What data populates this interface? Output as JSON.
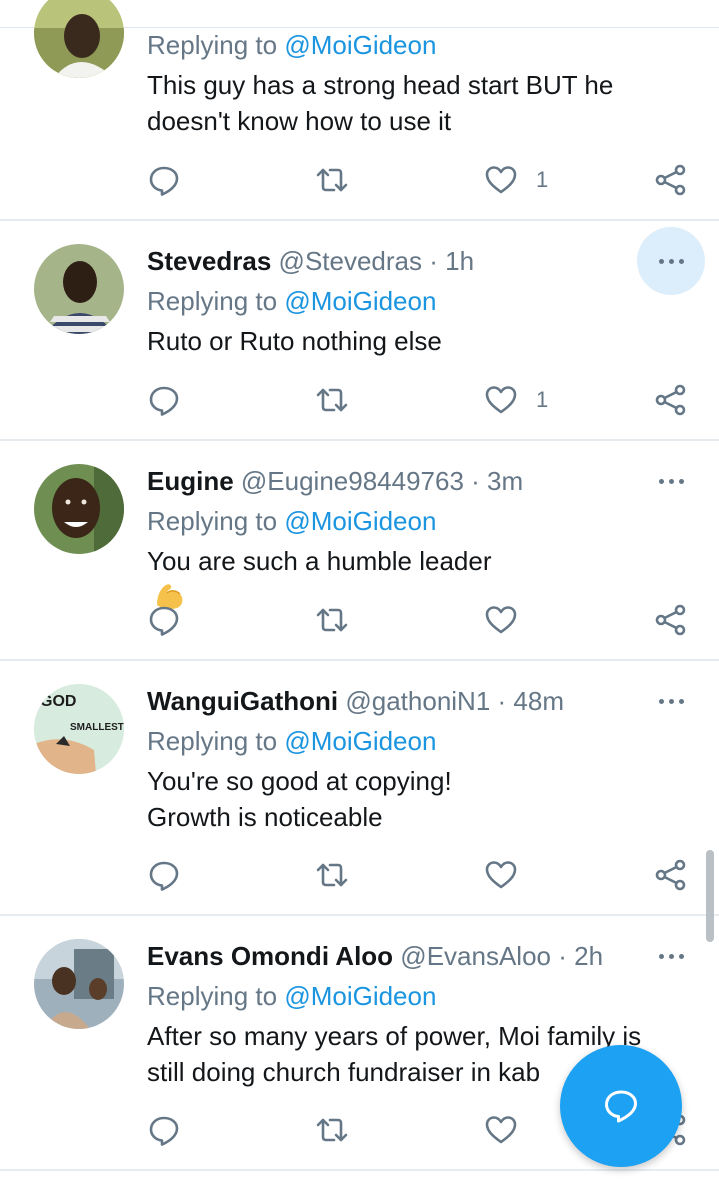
{
  "colors": {
    "accent": "#1da1f2",
    "link": "#1b95e0",
    "meta": "#657786",
    "text": "#14171a"
  },
  "tweets": [
    {
      "name": "",
      "handle": "",
      "time": "",
      "replying_prefix": "Replying to",
      "replying_to": "@MoiGideon",
      "text_lines": [
        "This guy has a strong head start BUT he",
        "doesn't know how to use it"
      ],
      "like_count": "1"
    },
    {
      "name": "Stevedras",
      "handle": "@Stevedras",
      "time": "· 1h",
      "replying_prefix": "Replying to",
      "replying_to": "@MoiGideon",
      "text_lines": [
        "Ruto or Ruto nothing else"
      ],
      "like_count": "1"
    },
    {
      "name": "Eugine",
      "handle": "@Eugine98449763",
      "time": "· 3m",
      "replying_prefix": "Replying to",
      "replying_to": "@MoiGideon",
      "text_lines": [
        "You are such a humble leader"
      ],
      "emoji": "flexed-biceps",
      "like_count": ""
    },
    {
      "name": "WanguiGathoni",
      "handle": "@gathoniN1",
      "time": "· 48m",
      "replying_prefix": "Replying to",
      "replying_to": "@MoiGideon",
      "text_lines": [
        "You're so good at copying!",
        "Growth is noticeable"
      ],
      "avatar_text": [
        "GOD",
        "SMALLEST"
      ],
      "like_count": ""
    },
    {
      "name": "Evans Omondi Aloo",
      "handle": "@EvansAloo",
      "time": "· 2h",
      "replying_prefix": "Replying to",
      "replying_to": "@MoiGideon",
      "text_lines": [
        "After so many years of power, Moi family is",
        "still doing church fundraiser in kab"
      ],
      "like_count": ""
    }
  ],
  "icons": {
    "reply": "reply-icon",
    "retweet": "retweet-icon",
    "like": "heart-icon",
    "share": "share-icon",
    "more": "more-options-icon",
    "compose": "compose-reply-icon"
  }
}
